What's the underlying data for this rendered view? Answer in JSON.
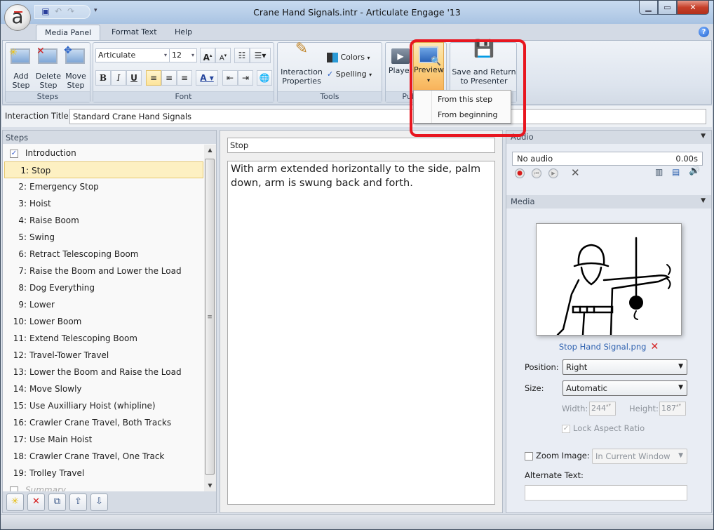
{
  "window": {
    "title": "Crane Hand Signals.intr -  Articulate Engage '13",
    "app_logo": "a",
    "controls": {
      "minimize": "minimize-icon",
      "maximize": "maximize-icon",
      "close": "close-icon"
    }
  },
  "quick_access": {
    "icons": [
      "save-icon",
      "undo-icon",
      "redo-icon",
      "customize-icon"
    ]
  },
  "tabs": [
    {
      "label": "Media Panel",
      "active": true
    },
    {
      "label": "Format Text",
      "active": false
    },
    {
      "label": "Help",
      "active": false
    }
  ],
  "ribbon": {
    "steps_group": {
      "label": "Steps",
      "add_step": "Add\nStep",
      "delete_step": "Delete\nStep",
      "move_step": "Move\nStep"
    },
    "font_group": {
      "label": "Font",
      "font_name": "Articulate",
      "font_size": "12",
      "buttons": [
        "grow-font",
        "shrink-font",
        "bullets",
        "numbering",
        "bold",
        "italic",
        "underline",
        "align-left",
        "align-center",
        "align-right",
        "font-color",
        "decrease-indent",
        "increase-indent",
        "hyperlink"
      ]
    },
    "tools_group": {
      "label": "Tools",
      "interaction_properties": "Interaction\nProperties",
      "colors": "Colors",
      "spelling": "Spelling"
    },
    "publish_group": {
      "label": "Publish",
      "player": "Player",
      "preview": "Preview"
    },
    "presenter_group": {
      "save_return": "Save and Return\nto Presenter"
    },
    "preview_menu": [
      "From this step",
      "From beginning"
    ]
  },
  "interaction": {
    "label": "Interaction Title:",
    "value": "Standard Crane Hand Signals"
  },
  "steps_panel": {
    "header": "Steps",
    "intro": {
      "label": "Introduction",
      "checked": true
    },
    "items": [
      {
        "num": "1:",
        "label": "Stop",
        "selected": true
      },
      {
        "num": "2:",
        "label": "Emergency Stop"
      },
      {
        "num": "3:",
        "label": "Hoist"
      },
      {
        "num": "4:",
        "label": "Raise Boom"
      },
      {
        "num": "5:",
        "label": "Swing"
      },
      {
        "num": "6:",
        "label": "Retract Telescoping Boom"
      },
      {
        "num": "7:",
        "label": "Raise the Boom and Lower the Load"
      },
      {
        "num": "8:",
        "label": "Dog Everything"
      },
      {
        "num": "9:",
        "label": "Lower"
      },
      {
        "num": "10:",
        "label": "Lower Boom"
      },
      {
        "num": "11:",
        "label": "Extend Telescoping Boom"
      },
      {
        "num": "12:",
        "label": "Travel-Tower Travel"
      },
      {
        "num": "13:",
        "label": "Lower the Boom and Raise the Load"
      },
      {
        "num": "14:",
        "label": "Move Slowly"
      },
      {
        "num": "15:",
        "label": "Use Auxilliary Hoist (whipline)"
      },
      {
        "num": "16:",
        "label": "Crawler Crane Travel, Both Tracks"
      },
      {
        "num": "17:",
        "label": "Use Main Hoist"
      },
      {
        "num": "18:",
        "label": "Crawler Crane Travel, One Track"
      },
      {
        "num": "19:",
        "label": "Trolley Travel"
      }
    ],
    "summary": {
      "label": "Summary",
      "checked": false
    },
    "toolbar_icons": [
      "add-step-icon",
      "delete-step-icon",
      "copy-step-icon",
      "move-up-icon",
      "move-down-icon"
    ]
  },
  "editor": {
    "step_title": "Stop",
    "step_text": "With arm extended horizontally to the side, palm down, arm is swung back and forth."
  },
  "audio": {
    "header": "Audio",
    "status": "No audio",
    "duration": "0.00s"
  },
  "media": {
    "header": "Media",
    "file_name": "Stop Hand Signal.png",
    "position_label": "Position:",
    "position_value": "Right",
    "size_label": "Size:",
    "size_value": "Automatic",
    "width_label": "Width:",
    "width_value": "244",
    "height_label": "Height:",
    "height_value": "187",
    "lock_aspect_label": "Lock Aspect Ratio",
    "lock_aspect_checked": true,
    "zoom_label": "Zoom Image:",
    "zoom_checked": false,
    "zoom_value": "In Current Window",
    "alt_text_label": "Alternate Text:",
    "alt_text_value": ""
  },
  "colors": {
    "highlight": "#e8161f",
    "selection": "#fdf0c2",
    "preview_active": "#f8b25a",
    "link": "#2f62b0"
  }
}
